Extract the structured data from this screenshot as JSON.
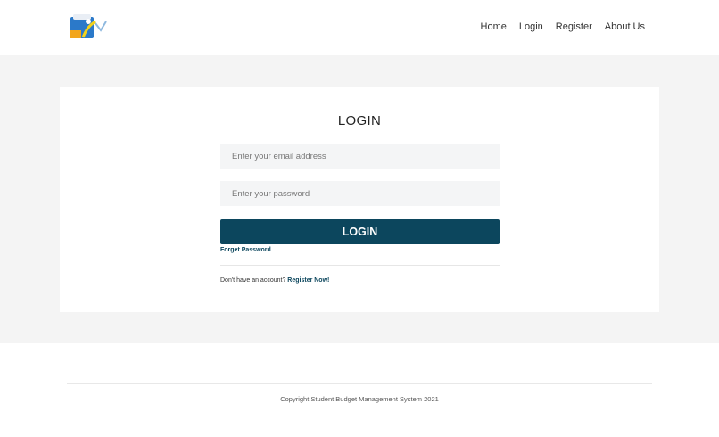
{
  "header": {
    "logo_icon": "budget-app-logo-icon",
    "nav": [
      {
        "label": "Home"
      },
      {
        "label": "Login"
      },
      {
        "label": "Register"
      },
      {
        "label": "About Us"
      }
    ]
  },
  "login": {
    "title": "LOGIN",
    "email_placeholder": "Enter your email address",
    "password_placeholder": "Enter your password",
    "button_label": "LOGIN",
    "forgot_label": "Forget Password",
    "no_account_text": "Don't have an account?",
    "register_link": "Register Now!"
  },
  "footer": {
    "copyright": "Copyright Student Budget Management System 2021"
  },
  "colors": {
    "primary": "#0c465d",
    "band_background": "#f4f4f4",
    "input_background": "#f4f5f6"
  }
}
